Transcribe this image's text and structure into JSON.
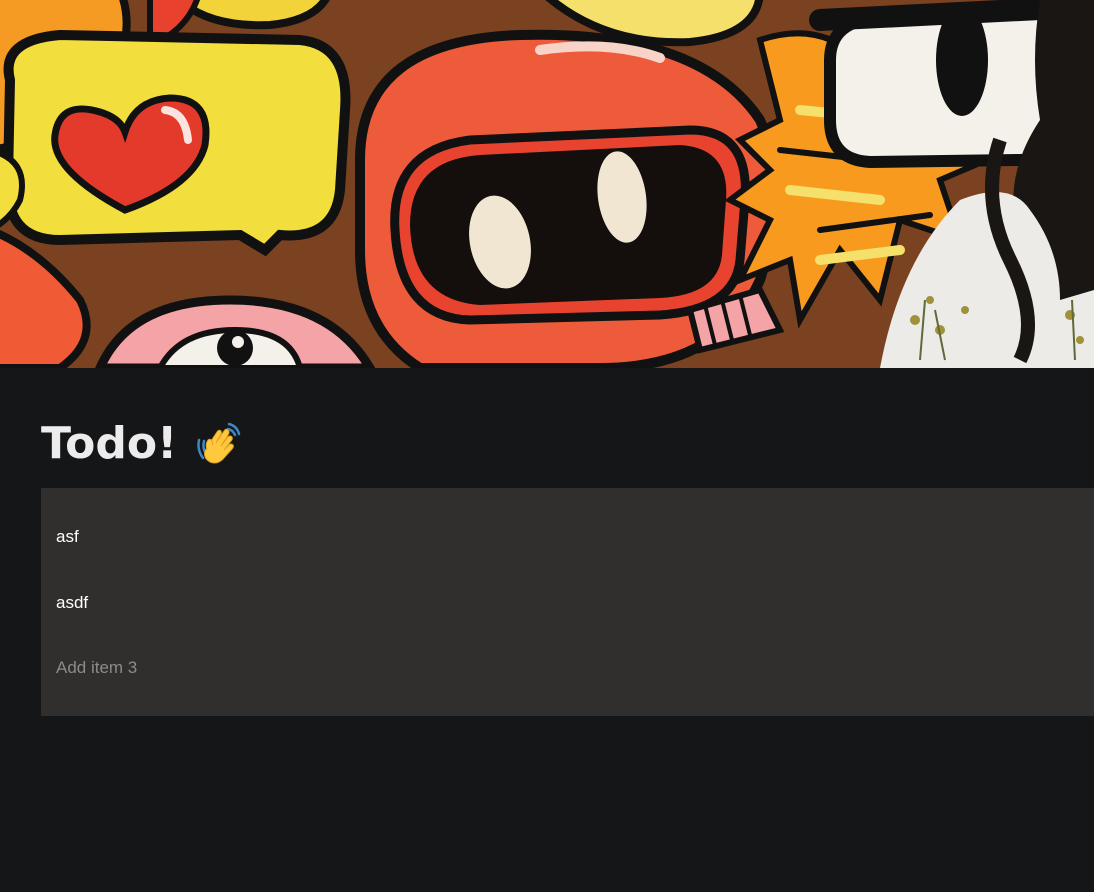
{
  "page": {
    "title": "Todo!",
    "title_emoji": "waving-hand-icon"
  },
  "todo": {
    "items": [
      {
        "label": "asf"
      },
      {
        "label": "asdf"
      }
    ],
    "add_placeholder": "Add item 3"
  },
  "colors": {
    "background": "#151618",
    "list_background": "#302f2d",
    "title_text": "#ececec",
    "item_text": "#ffffff",
    "placeholder_text": "#8c8b89"
  }
}
